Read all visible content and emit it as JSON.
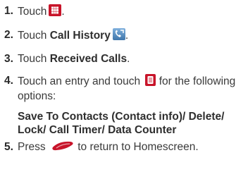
{
  "steps": [
    {
      "num": "1.",
      "text": "Touch",
      "after": ".",
      "icon": "apps-grid-icon"
    },
    {
      "num": "2.",
      "text": "Touch",
      "bold": "Call History",
      "after": ".",
      "icon": "call-history-icon"
    },
    {
      "num": "3.",
      "text": "Touch",
      "bold": "Received Calls",
      "after": "."
    },
    {
      "num": "4.",
      "text_before": "Touch an entry and touch",
      "text_after": "for the following options:",
      "icon": "menu-icon"
    },
    {
      "num": "5.",
      "text_before": "Press",
      "text_after": "to return to Homescreen.",
      "icon": "end-key-icon"
    }
  ],
  "options": {
    "a": "Save To Contacts",
    "b_open": "(",
    "b": "Contact info",
    "b_close": ")/",
    "c": "Delete/ Lock/ Call Timer/ Data Counter"
  },
  "colors": {
    "icon_red": "#c8142a",
    "icon_blue": "#4a84b8"
  }
}
